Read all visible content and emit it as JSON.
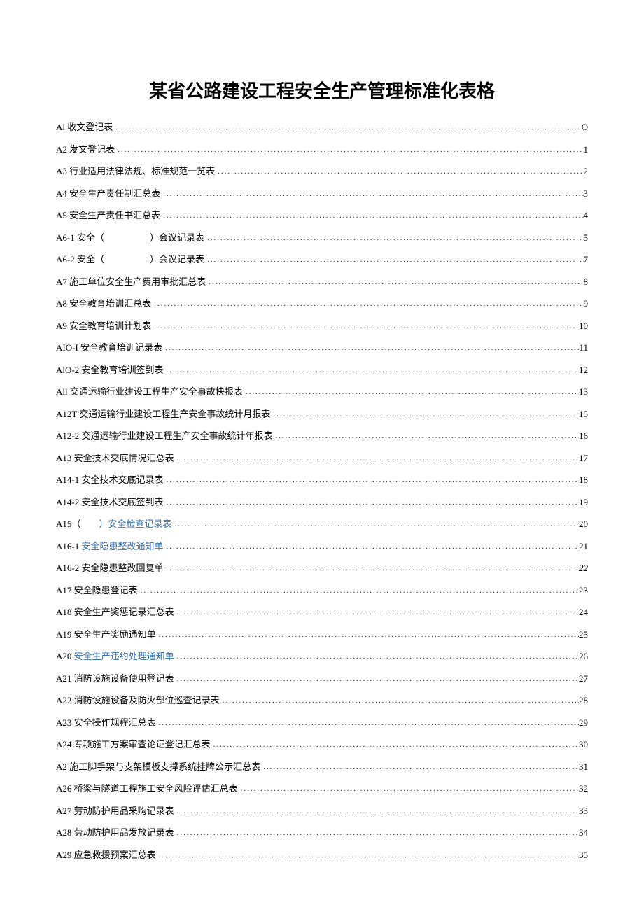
{
  "title": "某省公路建设工程安全生产管理标准化表格",
  "toc": [
    {
      "label": "Al 收文登记表",
      "page": "O"
    },
    {
      "label": "A2 发文登记表",
      "page": "1"
    },
    {
      "label": "A3 行业适用法律法规、标准规范一览表",
      "page": "2"
    },
    {
      "label": "A4 安全生产责任制汇总表",
      "page": "3"
    },
    {
      "label": "A5 安全生产责任书汇总表",
      "page": "4"
    },
    {
      "label": "A6-1 安全（　　　　　）会议记录表",
      "page": "5"
    },
    {
      "label": "A6-2 安全（　　　　　）会议记录表",
      "page": "7"
    },
    {
      "label": "A7 施工单位安全生产费用审批汇总表",
      "page": "8"
    },
    {
      "label": "A8 安全教育培训汇总表",
      "page": "9"
    },
    {
      "label": "A9 安全教育培训计划表",
      "page": "10"
    },
    {
      "label": "AIO-I 安全教育培训记录表",
      "page": "11"
    },
    {
      "label": "AlO-2 安全教育培训签到表",
      "page": "12"
    },
    {
      "label": "All 交通运输行业建设工程生产安全事故快报表",
      "page": "13"
    },
    {
      "label": "A12T 交通运输行业建设工程生产安全事故统计月报表",
      "page": "15"
    },
    {
      "label": "A12-2 交通运输行业建设工程生产安全事故统计年报表",
      "page": "16"
    },
    {
      "label": "A13 安全技术交底情况汇总表",
      "page": "17"
    },
    {
      "label": "A14-1 安全技术交底记录表",
      "page": "18"
    },
    {
      "label": "A14-2 安全技术交底签到表",
      "page": "19"
    },
    {
      "label_pre": "A15（　　",
      "label_accent": "）安全检查记录表",
      "page": "20"
    },
    {
      "label_pre": "A16-1 ",
      "label_accent": "安全隐患整改通知单",
      "page": "21"
    },
    {
      "label": "A16-2 安全隐患整改回复单",
      "page": "22",
      "page_italic": true
    },
    {
      "label": "A17 安全隐患登记表",
      "page": "23"
    },
    {
      "label": "A18 安全生产奖惩记录汇总表",
      "page": "24"
    },
    {
      "label": "A19 安全生产奖励通知单",
      "page": "25"
    },
    {
      "label_pre": "A20 ",
      "label_accent": "安全生产违约处理通知单",
      "page": "26"
    },
    {
      "label": "A21 消防设施设备使用登记表",
      "page": "27"
    },
    {
      "label": "A22 消防设施设备及防火部位巡查记录表",
      "page": "28"
    },
    {
      "label": "A23 安全操作规程汇总表",
      "page": "29"
    },
    {
      "label": "A24 专项施工方案审查论证登记汇总表",
      "page": "30"
    },
    {
      "label": "A2 施工脚手架与支架模板支撑系统挂牌公示汇总表",
      "page": "31"
    },
    {
      "label": "A26 桥梁与隧道工程施工安全风险评估汇总表",
      "page": "32"
    },
    {
      "label": "A27 劳动防护用品采购记录表",
      "page": "33"
    },
    {
      "label": "A28 劳动防护用品发放记录表",
      "page": "34"
    },
    {
      "label": "A29 应急救援预案汇总表",
      "page": "35"
    }
  ]
}
